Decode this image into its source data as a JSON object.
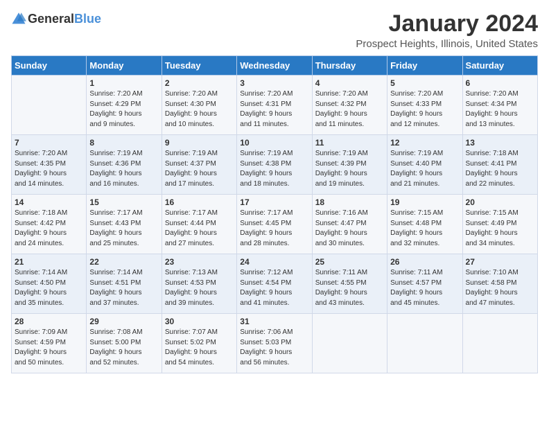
{
  "logo": {
    "general": "General",
    "blue": "Blue"
  },
  "title": "January 2024",
  "location": "Prospect Heights, Illinois, United States",
  "days_of_week": [
    "Sunday",
    "Monday",
    "Tuesday",
    "Wednesday",
    "Thursday",
    "Friday",
    "Saturday"
  ],
  "weeks": [
    [
      {
        "day": "",
        "sunrise": "",
        "sunset": "",
        "daylight": ""
      },
      {
        "day": "1",
        "sunrise": "Sunrise: 7:20 AM",
        "sunset": "Sunset: 4:29 PM",
        "daylight": "Daylight: 9 hours and 9 minutes."
      },
      {
        "day": "2",
        "sunrise": "Sunrise: 7:20 AM",
        "sunset": "Sunset: 4:30 PM",
        "daylight": "Daylight: 9 hours and 10 minutes."
      },
      {
        "day": "3",
        "sunrise": "Sunrise: 7:20 AM",
        "sunset": "Sunset: 4:31 PM",
        "daylight": "Daylight: 9 hours and 11 minutes."
      },
      {
        "day": "4",
        "sunrise": "Sunrise: 7:20 AM",
        "sunset": "Sunset: 4:32 PM",
        "daylight": "Daylight: 9 hours and 11 minutes."
      },
      {
        "day": "5",
        "sunrise": "Sunrise: 7:20 AM",
        "sunset": "Sunset: 4:33 PM",
        "daylight": "Daylight: 9 hours and 12 minutes."
      },
      {
        "day": "6",
        "sunrise": "Sunrise: 7:20 AM",
        "sunset": "Sunset: 4:34 PM",
        "daylight": "Daylight: 9 hours and 13 minutes."
      }
    ],
    [
      {
        "day": "7",
        "sunrise": "Sunrise: 7:20 AM",
        "sunset": "Sunset: 4:35 PM",
        "daylight": "Daylight: 9 hours and 14 minutes."
      },
      {
        "day": "8",
        "sunrise": "Sunrise: 7:19 AM",
        "sunset": "Sunset: 4:36 PM",
        "daylight": "Daylight: 9 hours and 16 minutes."
      },
      {
        "day": "9",
        "sunrise": "Sunrise: 7:19 AM",
        "sunset": "Sunset: 4:37 PM",
        "daylight": "Daylight: 9 hours and 17 minutes."
      },
      {
        "day": "10",
        "sunrise": "Sunrise: 7:19 AM",
        "sunset": "Sunset: 4:38 PM",
        "daylight": "Daylight: 9 hours and 18 minutes."
      },
      {
        "day": "11",
        "sunrise": "Sunrise: 7:19 AM",
        "sunset": "Sunset: 4:39 PM",
        "daylight": "Daylight: 9 hours and 19 minutes."
      },
      {
        "day": "12",
        "sunrise": "Sunrise: 7:19 AM",
        "sunset": "Sunset: 4:40 PM",
        "daylight": "Daylight: 9 hours and 21 minutes."
      },
      {
        "day": "13",
        "sunrise": "Sunrise: 7:18 AM",
        "sunset": "Sunset: 4:41 PM",
        "daylight": "Daylight: 9 hours and 22 minutes."
      }
    ],
    [
      {
        "day": "14",
        "sunrise": "Sunrise: 7:18 AM",
        "sunset": "Sunset: 4:42 PM",
        "daylight": "Daylight: 9 hours and 24 minutes."
      },
      {
        "day": "15",
        "sunrise": "Sunrise: 7:17 AM",
        "sunset": "Sunset: 4:43 PM",
        "daylight": "Daylight: 9 hours and 25 minutes."
      },
      {
        "day": "16",
        "sunrise": "Sunrise: 7:17 AM",
        "sunset": "Sunset: 4:44 PM",
        "daylight": "Daylight: 9 hours and 27 minutes."
      },
      {
        "day": "17",
        "sunrise": "Sunrise: 7:17 AM",
        "sunset": "Sunset: 4:45 PM",
        "daylight": "Daylight: 9 hours and 28 minutes."
      },
      {
        "day": "18",
        "sunrise": "Sunrise: 7:16 AM",
        "sunset": "Sunset: 4:47 PM",
        "daylight": "Daylight: 9 hours and 30 minutes."
      },
      {
        "day": "19",
        "sunrise": "Sunrise: 7:15 AM",
        "sunset": "Sunset: 4:48 PM",
        "daylight": "Daylight: 9 hours and 32 minutes."
      },
      {
        "day": "20",
        "sunrise": "Sunrise: 7:15 AM",
        "sunset": "Sunset: 4:49 PM",
        "daylight": "Daylight: 9 hours and 34 minutes."
      }
    ],
    [
      {
        "day": "21",
        "sunrise": "Sunrise: 7:14 AM",
        "sunset": "Sunset: 4:50 PM",
        "daylight": "Daylight: 9 hours and 35 minutes."
      },
      {
        "day": "22",
        "sunrise": "Sunrise: 7:14 AM",
        "sunset": "Sunset: 4:51 PM",
        "daylight": "Daylight: 9 hours and 37 minutes."
      },
      {
        "day": "23",
        "sunrise": "Sunrise: 7:13 AM",
        "sunset": "Sunset: 4:53 PM",
        "daylight": "Daylight: 9 hours and 39 minutes."
      },
      {
        "day": "24",
        "sunrise": "Sunrise: 7:12 AM",
        "sunset": "Sunset: 4:54 PM",
        "daylight": "Daylight: 9 hours and 41 minutes."
      },
      {
        "day": "25",
        "sunrise": "Sunrise: 7:11 AM",
        "sunset": "Sunset: 4:55 PM",
        "daylight": "Daylight: 9 hours and 43 minutes."
      },
      {
        "day": "26",
        "sunrise": "Sunrise: 7:11 AM",
        "sunset": "Sunset: 4:57 PM",
        "daylight": "Daylight: 9 hours and 45 minutes."
      },
      {
        "day": "27",
        "sunrise": "Sunrise: 7:10 AM",
        "sunset": "Sunset: 4:58 PM",
        "daylight": "Daylight: 9 hours and 47 minutes."
      }
    ],
    [
      {
        "day": "28",
        "sunrise": "Sunrise: 7:09 AM",
        "sunset": "Sunset: 4:59 PM",
        "daylight": "Daylight: 9 hours and 50 minutes."
      },
      {
        "day": "29",
        "sunrise": "Sunrise: 7:08 AM",
        "sunset": "Sunset: 5:00 PM",
        "daylight": "Daylight: 9 hours and 52 minutes."
      },
      {
        "day": "30",
        "sunrise": "Sunrise: 7:07 AM",
        "sunset": "Sunset: 5:02 PM",
        "daylight": "Daylight: 9 hours and 54 minutes."
      },
      {
        "day": "31",
        "sunrise": "Sunrise: 7:06 AM",
        "sunset": "Sunset: 5:03 PM",
        "daylight": "Daylight: 9 hours and 56 minutes."
      },
      {
        "day": "",
        "sunrise": "",
        "sunset": "",
        "daylight": ""
      },
      {
        "day": "",
        "sunrise": "",
        "sunset": "",
        "daylight": ""
      },
      {
        "day": "",
        "sunrise": "",
        "sunset": "",
        "daylight": ""
      }
    ]
  ]
}
